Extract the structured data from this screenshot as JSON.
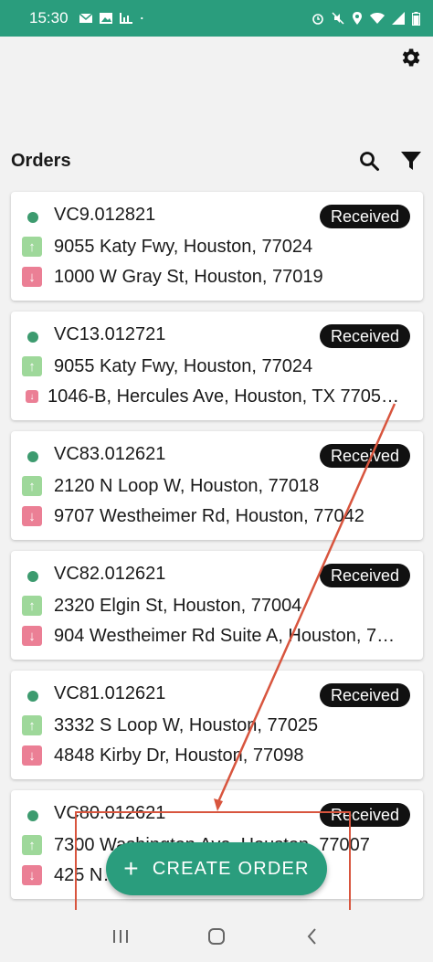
{
  "status_bar": {
    "time": "15:30"
  },
  "header": {
    "title": "Orders"
  },
  "orders": [
    {
      "id": "VC9.012821",
      "status": "Received",
      "pickup": "9055 Katy Fwy, Houston, 77024",
      "dropoff": "1000 W Gray St, Houston, 77019"
    },
    {
      "id": "VC13.012721",
      "status": "Received",
      "pickup": "9055 Katy Fwy, Houston, 77024",
      "dropoff": "1046-B, Hercules Ave, Houston, TX 7705…"
    },
    {
      "id": "VC83.012621",
      "status": "Received",
      "pickup": "2120 N Loop W, Houston, 77018",
      "dropoff": "9707 Westheimer Rd, Houston, 77042"
    },
    {
      "id": "VC82.012621",
      "status": "Received",
      "pickup": "2320 Elgin St, Houston, 77004",
      "dropoff": "904 Westheimer Rd Suite A, Houston, 7…"
    },
    {
      "id": "VC81.012621",
      "status": "Received",
      "pickup": "3332 S Loop W, Houston, 77025",
      "dropoff": "4848 Kirby Dr, Houston, 77098"
    },
    {
      "id": "VC80.012621",
      "status": "Received",
      "pickup": "7300 Washington Ave, Houston, 77007",
      "dropoff": "425 N…, Houston, 7…"
    }
  ],
  "fab": {
    "plus": "+",
    "label": "CREATE ORDER"
  },
  "colors": {
    "primary": "#2a9d7d",
    "badge": "#111111",
    "pickup": "#9ed89a",
    "dropoff": "#eb7f95",
    "dot": "#3d9b6f",
    "annotation": "#d8553e"
  },
  "icons": {
    "settings": "gear-icon",
    "search": "search-icon",
    "filter": "filter-icon",
    "pickup": "arrow-up-icon",
    "dropoff": "arrow-down-icon"
  }
}
